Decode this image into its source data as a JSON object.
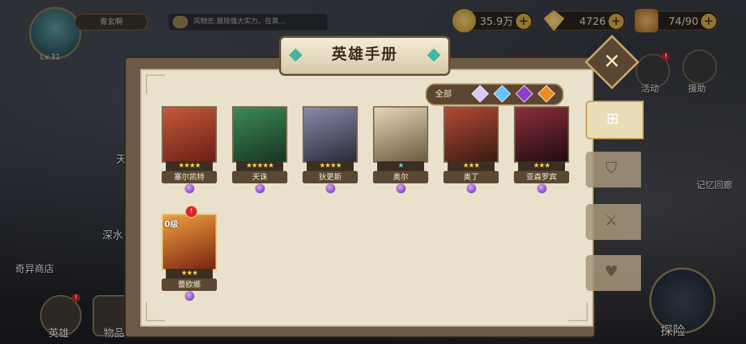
{
  "player": {
    "level": "Lv.31",
    "name": "青玄啊"
  },
  "chat": {
    "text": "风物志:展现强大实力，在黄..."
  },
  "currency": [
    {
      "icon": "gold-coin-icon",
      "value": "35.9万",
      "color": "#e6b43c"
    },
    {
      "icon": "diamond-icon",
      "value": "4726",
      "color": "#f0a21c"
    },
    {
      "icon": "stamina-icon",
      "value": "74/90",
      "color": "#d99a3b"
    }
  ],
  "right_menu": {
    "activity": "活动",
    "support": "援助",
    "memory": "记忆回廊"
  },
  "left_menu": {
    "shop": "奇异商店",
    "deep_water": "深水",
    "tian": "天"
  },
  "bottom_menu": {
    "hero": "英雄",
    "items": "物品",
    "explore": "探险"
  },
  "book": {
    "title": "英雄手册",
    "filter_all": "全部",
    "filter_gems": [
      "#d8c9ff",
      "#63c3ff",
      "#8b3fd0",
      "#f08a22"
    ],
    "tabs": [
      "grid-icon",
      "shield-icon",
      "sword-icon",
      "heart-icon"
    ]
  },
  "heroes": [
    {
      "name": "塞尔凯特",
      "stars": "★★★★",
      "color": "#b9452e"
    },
    {
      "name": "天诛",
      "stars": "★★★★★",
      "color": "#2f6b43"
    },
    {
      "name": "狄更斯",
      "stars": "★★★★",
      "color": "#5a5a7a"
    },
    {
      "name": "奥尔",
      "stars": "★",
      "color": "#c9b38a"
    },
    {
      "name": "奥丁",
      "stars": "★★★",
      "color": "#8c3b2b"
    },
    {
      "name": "亚森罗宾",
      "stars": "★★★",
      "color": "#6b2530"
    },
    {
      "name": "蕾欧娜",
      "stars": "★★★",
      "color": "#e07a2a",
      "level": "0级",
      "alert": "!"
    }
  ]
}
